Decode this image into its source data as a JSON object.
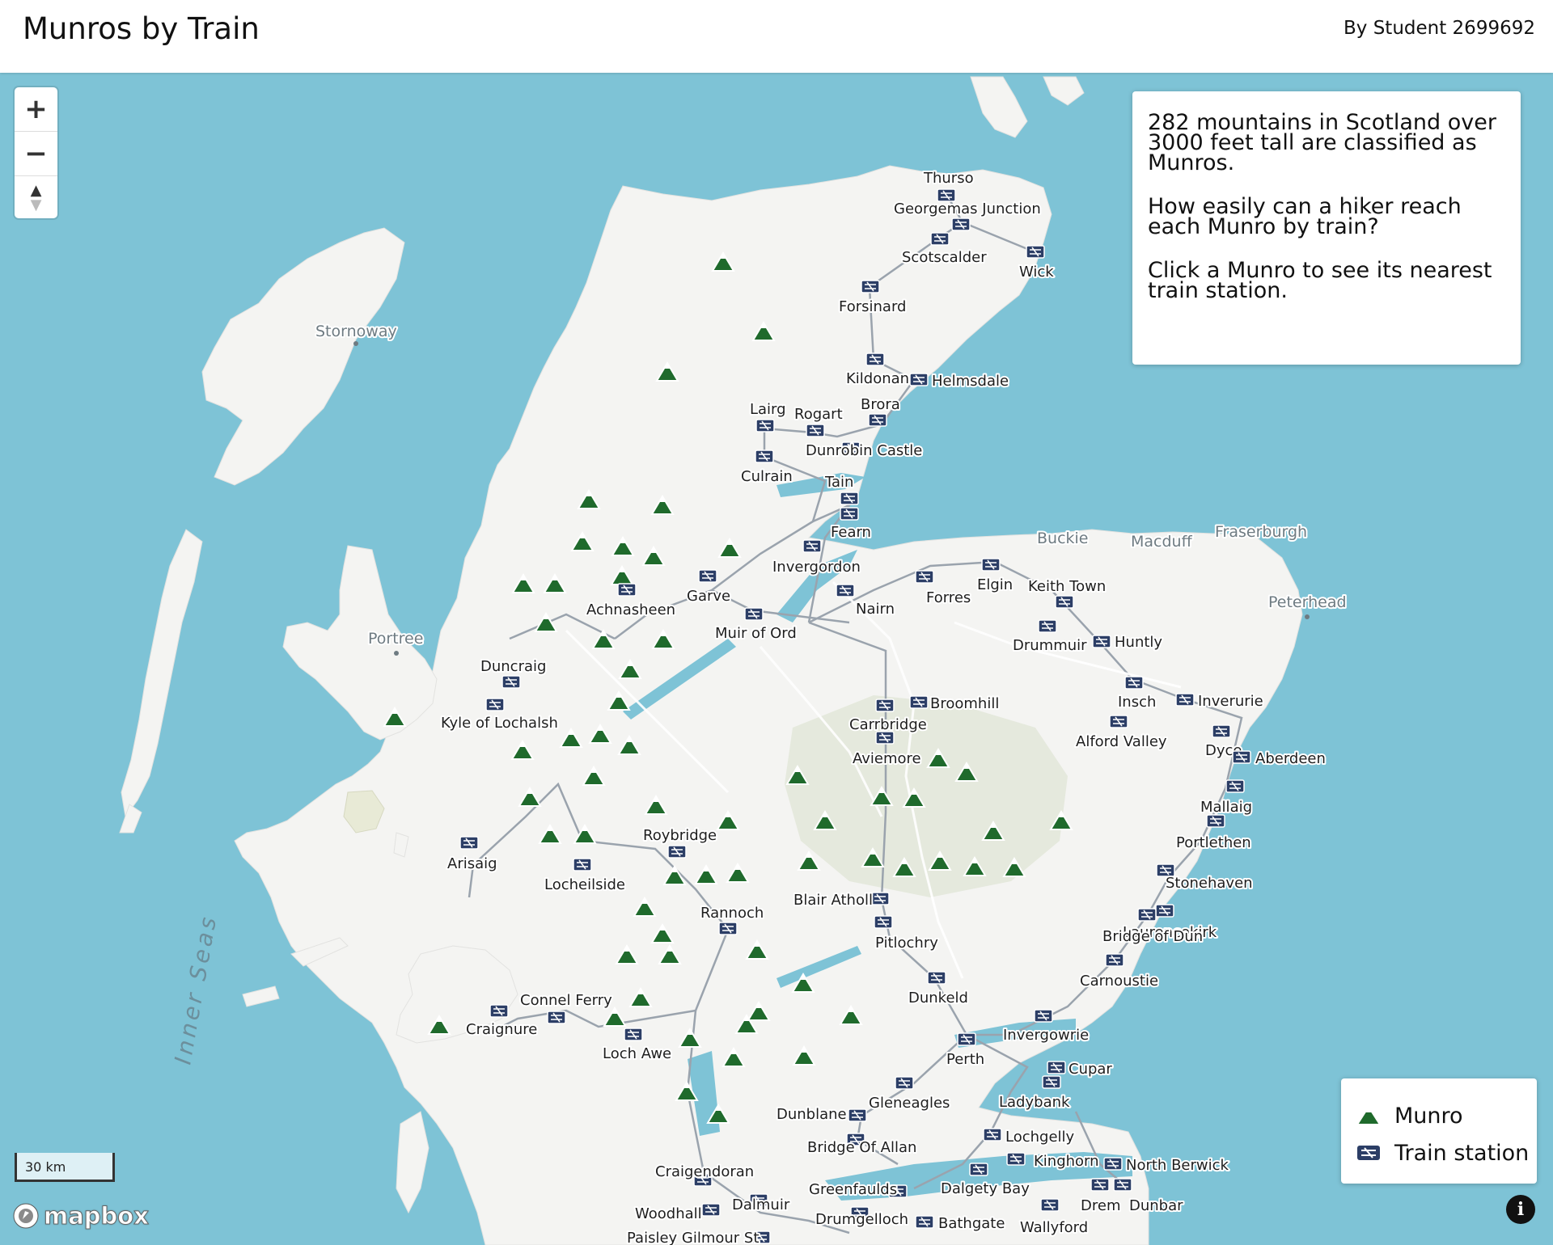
{
  "header": {
    "title": "Munros by Train",
    "byline": "By Student 2699692"
  },
  "info_panel": {
    "paragraphs": [
      "282 mountains in Scotland over 3000 feet tall are classified as Munros.",
      "How easily can a hiker reach each Munro by train?",
      "Click a Munro to see its nearest train station."
    ]
  },
  "legend": {
    "munro_label": "Munro",
    "station_label": "Train station"
  },
  "zoom_controls": {
    "zoom_in": "+",
    "zoom_out": "−",
    "compass": "▲"
  },
  "scale_bar": {
    "label": "30 km"
  },
  "attribution": {
    "logo_text": "mapbox",
    "info_icon": "i"
  },
  "colors": {
    "sea": "#7ec3d6",
    "land": "#f4f4f2",
    "munro": "#1f6a2c",
    "station": "#2c3e66"
  },
  "map": {
    "towns": [
      "Stornoway",
      "Portree",
      "Buckie",
      "Macduff",
      "Fraserburgh",
      "Peterhead"
    ],
    "sea_label": "Inner Seas",
    "stations": [
      "Thurso",
      "Georgemas Junction",
      "Scotscalder",
      "Wick",
      "Forsinard",
      "Kildonan",
      "Helmsdale",
      "Brora",
      "Lairg",
      "Rogart",
      "Dunrobin Castle",
      "Culrain",
      "Tain",
      "Fearn",
      "Invergordon",
      "Garve",
      "Achnasheen",
      "Muir of Ord",
      "Nairn",
      "Forres",
      "Elgin",
      "Keith Town",
      "Drummuir",
      "Huntly",
      "Duncraig",
      "Kyle of Lochalsh",
      "Broomhill",
      "Carrbridge",
      "Insch",
      "Inverurie",
      "Alford Valley",
      "Aviemore",
      "Dyce",
      "Aberdeen",
      "Mallaig",
      "Portlethen",
      "Roybridge",
      "Stonehaven",
      "Arisaig",
      "Locheilside",
      "Laurencekirk",
      "Blair Atholl",
      "Rannoch",
      "Bridge of Dun",
      "Pitlochry",
      "Carnoustie",
      "Dunkeld",
      "Connel Ferry",
      "Craignure",
      "Invergowrie",
      "Loch Awe",
      "Perth",
      "Cupar",
      "Gleneagles",
      "Ladybank",
      "Dunblane",
      "Lochgelly",
      "Bridge Of Allan",
      "Kinghorn",
      "North Berwick",
      "Craigendoran",
      "Dalgety Bay",
      "Greenfaulds",
      "Drem",
      "Dunbar",
      "Dalmuir",
      "Woodhall",
      "Drumgelloch",
      "Bathgate",
      "Wallyford",
      "Paisley Gilmour St"
    ]
  }
}
